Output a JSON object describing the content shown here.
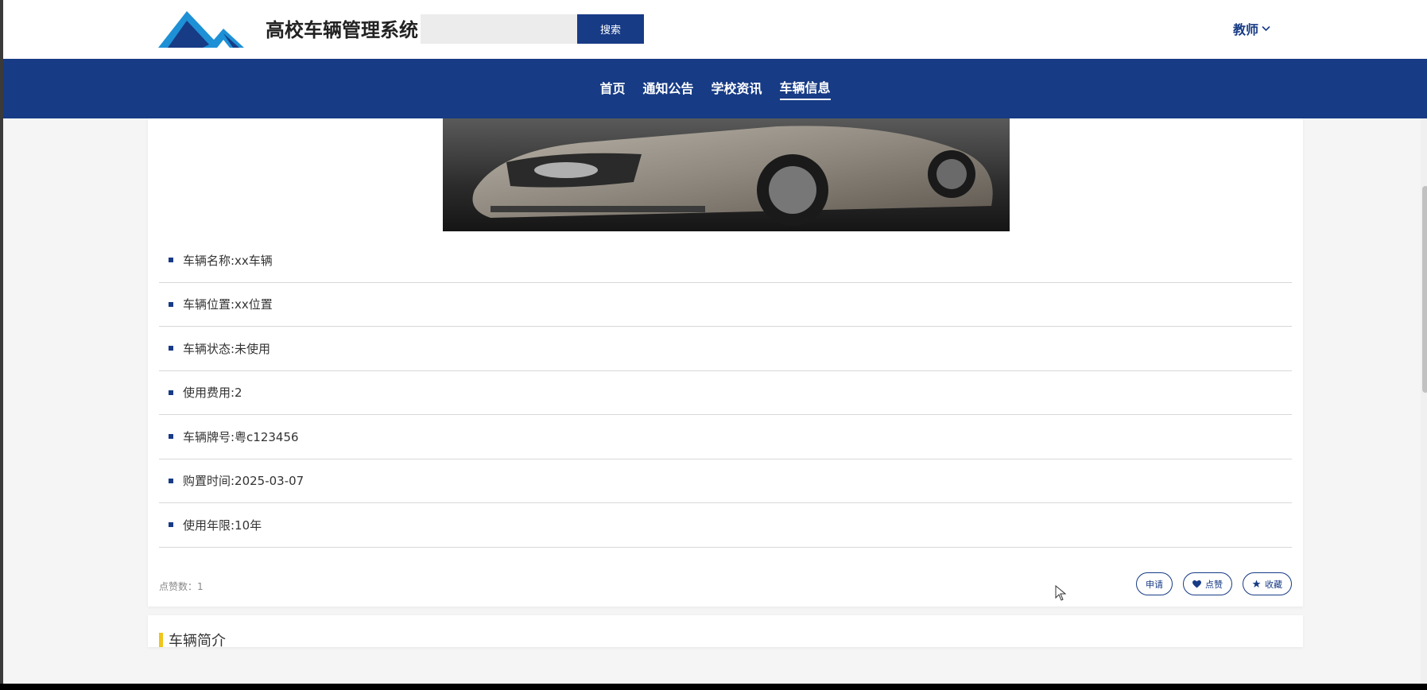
{
  "header": {
    "site_title": "高校车辆管理系统",
    "search_placeholder": "",
    "search_button": "搜索",
    "user_label": "教师",
    "colors": {
      "primary": "#173b85",
      "logo_blue": "#1e90d6"
    }
  },
  "nav": {
    "items": [
      {
        "label": "首页",
        "active": false
      },
      {
        "label": "通知公告",
        "active": false
      },
      {
        "label": "学校资讯",
        "active": false
      },
      {
        "label": "车辆信息",
        "active": true
      }
    ]
  },
  "detail": {
    "fields": [
      {
        "text": "车辆名称:xx车辆"
      },
      {
        "text": "车辆位置:xx位置"
      },
      {
        "text": "车辆状态:未使用"
      },
      {
        "text": "使用费用:2"
      },
      {
        "text": "车辆牌号:粤c123456"
      },
      {
        "text": "购置时间:2025-03-07"
      },
      {
        "text": "使用年限:10年"
      }
    ],
    "likes_text": "点赞数：1",
    "buttons": {
      "apply": "申请",
      "like": "点赞",
      "favorite": "收藏"
    }
  },
  "section2": {
    "heading": "车辆简介"
  }
}
